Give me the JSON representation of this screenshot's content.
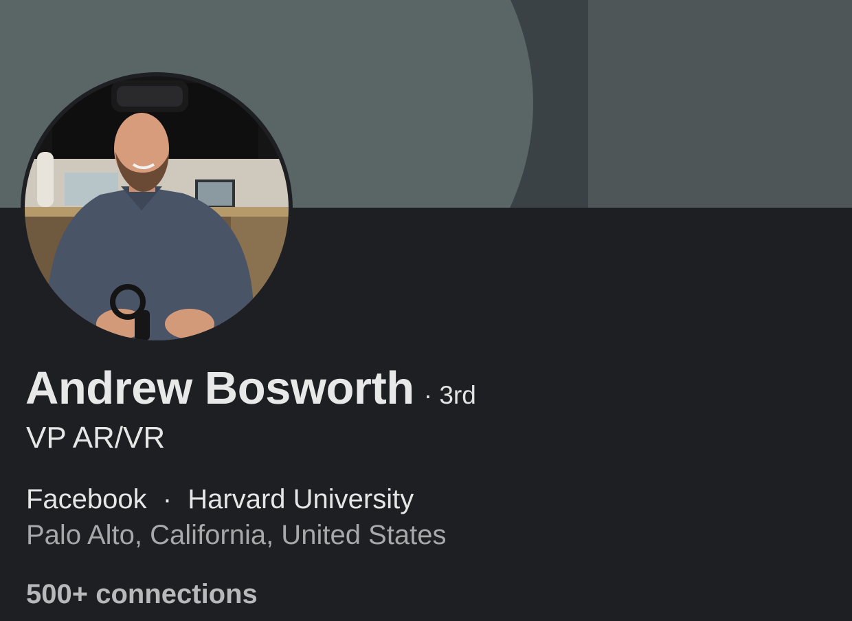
{
  "profile": {
    "name": "Andrew Bosworth",
    "degree": "· 3rd",
    "headline": "VP AR/VR",
    "company": "Facebook",
    "separator": "·",
    "school": "Harvard University",
    "location": "Palo Alto, California, United States",
    "connections": "500+ connections"
  },
  "colors": {
    "background": "#1d1f22",
    "banner_base": "#3b4246",
    "banner_shape": "#5a6566",
    "banner_panel": "#4e5658",
    "primary_text": "#e6e6e6",
    "secondary_text": "#a6a8aa"
  }
}
